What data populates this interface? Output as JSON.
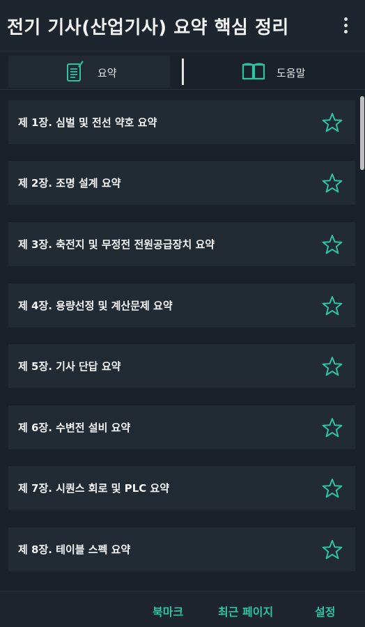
{
  "app": {
    "title": "전기 기사(산업기사) 요약 핵심 정리",
    "accent_color": "#2fc4a2",
    "overflow_icon": "more-vert-icon"
  },
  "tabs": [
    {
      "label": "요약",
      "icon": "notepad-icon",
      "selected": true
    },
    {
      "label": "도움말",
      "icon": "book-icon",
      "selected": false
    }
  ],
  "chapters": [
    {
      "label": "제 1장. 심벌 및 전선 약호 요약",
      "bookmarked": false
    },
    {
      "label": "제 2장. 조명 설계 요약",
      "bookmarked": false
    },
    {
      "label": "제 3장. 축전지 및 무정전 전원공급장치 요약",
      "bookmarked": false
    },
    {
      "label": "제 4장. 용량선정 및 계산문제 요약",
      "bookmarked": false
    },
    {
      "label": "제 5장. 기사 단답 요약",
      "bookmarked": false
    },
    {
      "label": "제 6장. 수변전 설비 요약",
      "bookmarked": false
    },
    {
      "label": "제 7장. 시퀀스 회로 및 PLC 요약",
      "bookmarked": false
    },
    {
      "label": "제 8장. 테이블 스펙 요약",
      "bookmarked": false
    }
  ],
  "bottom_nav": {
    "bookmark": "북마크",
    "recent_page": "최근 페이지",
    "settings": "설정"
  }
}
